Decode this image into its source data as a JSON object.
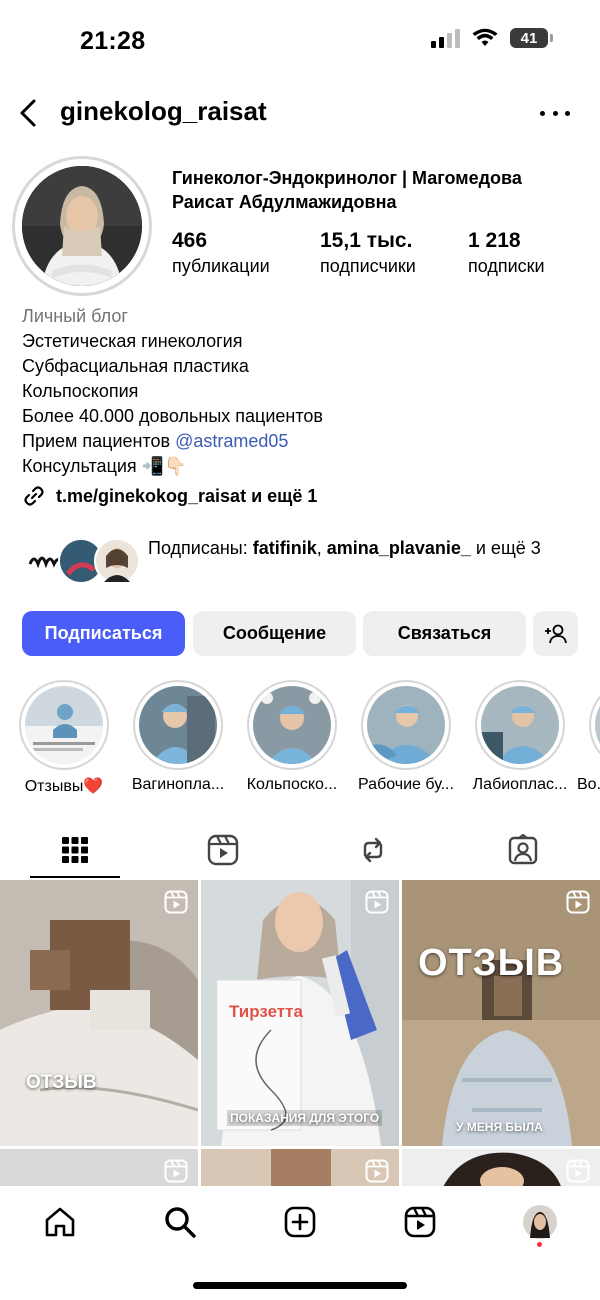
{
  "status_bar": {
    "time": "21:28",
    "battery": "41"
  },
  "header": {
    "username": "ginekolog_raisat"
  },
  "profile": {
    "full_name": "Гинеколог-Эндокринолог | Магомедова Раисат Абдулмажидовна",
    "stats": [
      {
        "value": "466",
        "label": "публикации"
      },
      {
        "value": "15,1 тыс.",
        "label": "подписчики"
      },
      {
        "value": "1 218",
        "label": "подписки"
      }
    ],
    "category": "Личный блог",
    "bio_lines": [
      "Эстетическая гинекология",
      "Субфасциальная пластика",
      "Кольпоскопия",
      "Более 40.000 довольных пациентов"
    ],
    "bio_reception_prefix": "Прием пациентов ",
    "bio_reception_mention": "@astramed05",
    "bio_consult": "Консультация 📲👇🏻",
    "link": "t.me/ginekokog_raisat и ещё 1",
    "followed_by": {
      "prefix": "Подписаны: ",
      "user1": "fatifinik",
      "separator": ", ",
      "user2": "amina_plavanie_",
      "suffix": " и ещё 3"
    }
  },
  "buttons": {
    "follow": "Подписаться",
    "message": "Сообщение",
    "contact": "Связаться"
  },
  "highlights": [
    {
      "label": "Отзывы❤️"
    },
    {
      "label": "Вагинопла..."
    },
    {
      "label": "Кольпоско..."
    },
    {
      "label": "Рабочие бу..."
    },
    {
      "label": "Лабиоплас..."
    },
    {
      "label": "Во..."
    }
  ],
  "posts": [
    {
      "caption": "ОТЗЫВ"
    },
    {
      "caption": "ПОКАЗАНИЯ ДЛЯ ЭТОГО",
      "product": "Тирзетта"
    },
    {
      "caption": "ОТЗЫВ",
      "subcaption": "У МЕНЯ БЫЛА"
    }
  ],
  "colors": {
    "accent": "#4a5df9",
    "mention": "#3b5bb5",
    "muted": "#737373",
    "button_bg": "#efefef"
  }
}
